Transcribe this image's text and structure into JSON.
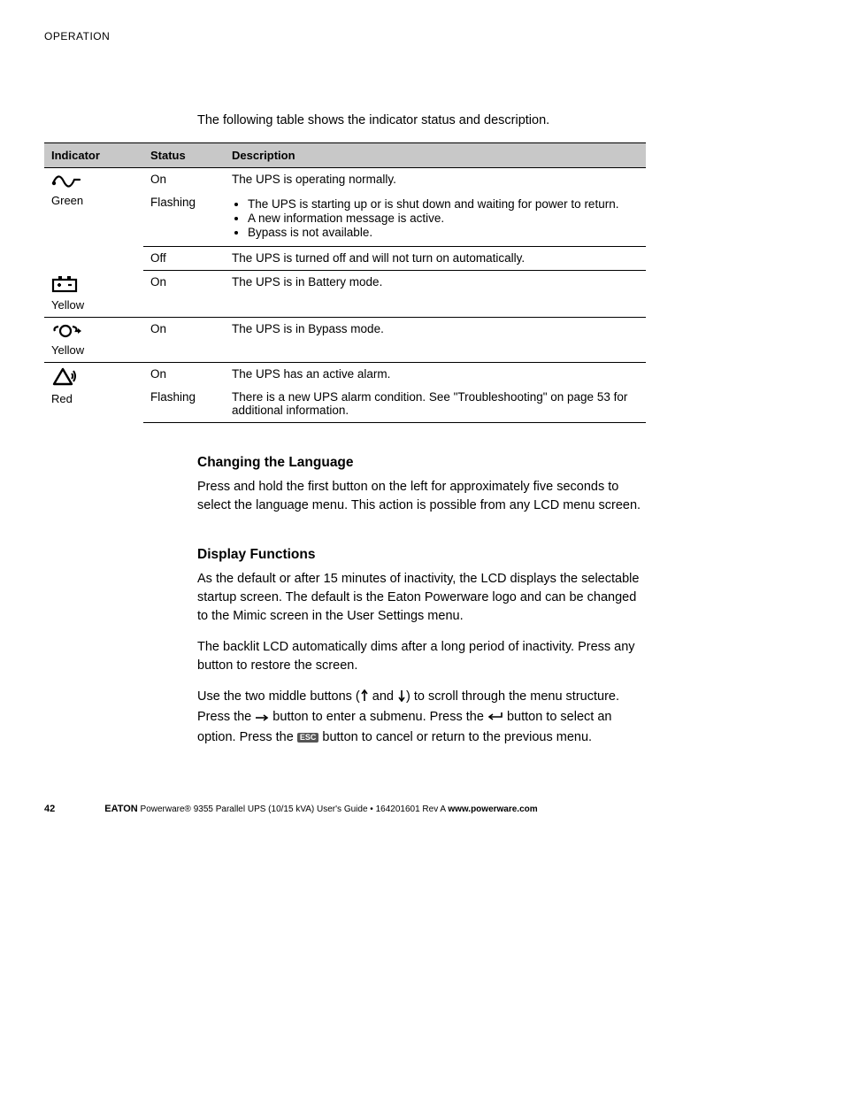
{
  "header": {
    "running_head": "OPERATION"
  },
  "intro": "The following table shows the indicator status and description.",
  "table": {
    "headers": {
      "c1": "Indicator",
      "c2": "Status",
      "c3": "Description"
    },
    "rows": [
      {
        "indicator_color": "Green",
        "states": [
          {
            "status": "On",
            "desc_type": "text",
            "desc": "The UPS is operating normally."
          },
          {
            "status": "Flashing",
            "desc_type": "list",
            "list": [
              "The UPS is starting up or is shut down and waiting for power to return.",
              "A new information message is active.",
              "Bypass is not available."
            ]
          },
          {
            "status": "Off",
            "desc_type": "text",
            "desc": "The UPS is turned off and will not turn on automatically."
          }
        ]
      },
      {
        "indicator_color": "Yellow",
        "states": [
          {
            "status": "On",
            "desc_type": "text",
            "desc": "The UPS is in Battery mode."
          }
        ]
      },
      {
        "indicator_color": "Yellow",
        "states": [
          {
            "status": "On",
            "desc_type": "text",
            "desc": "The UPS is in Bypass mode."
          }
        ]
      },
      {
        "indicator_color": "Red",
        "states": [
          {
            "status": "On",
            "desc_type": "text",
            "desc": "The UPS has an active alarm."
          },
          {
            "status": "Flashing",
            "desc_type": "text",
            "desc": "There is a new UPS alarm condition. See \"Troubleshooting\" on page 53 for additional information."
          }
        ]
      }
    ]
  },
  "sections": {
    "lang_heading": "Changing the Language",
    "lang_body": "Press and hold the first button on the left for approximately five seconds to select the language menu. This action is possible from any LCD menu screen.",
    "disp_heading": "Display Functions",
    "disp_p1": "As the default or after 15 minutes of inactivity, the LCD displays the selectable startup screen. The default is the Eaton Powerware logo and can be changed to the Mimic screen in the User Settings menu.",
    "disp_p2": "The backlit LCD automatically dims after a long period of inactivity. Press any button to restore the screen.",
    "disp_p3_pre": "Use the two middle buttons (",
    "disp_p3_mid1": " and ",
    "disp_p3_mid2": ") to scroll through the menu structure. Press the ",
    "disp_p3_mid3": " button to enter a submenu. Press the ",
    "disp_p3_mid4": " button to select an option. Press the ",
    "disp_p3_end": " button to cancel or return to the previous menu.",
    "esc_label": "ESC"
  },
  "footer": {
    "page_number": "42",
    "brand": "EATON",
    "title_a": " Powerware® 9355 Parallel UPS (10/15 kVA) User's Guide ",
    "bullet": " • ",
    "docnum": " 164201601 Rev A ",
    "url": "www.powerware.com"
  }
}
